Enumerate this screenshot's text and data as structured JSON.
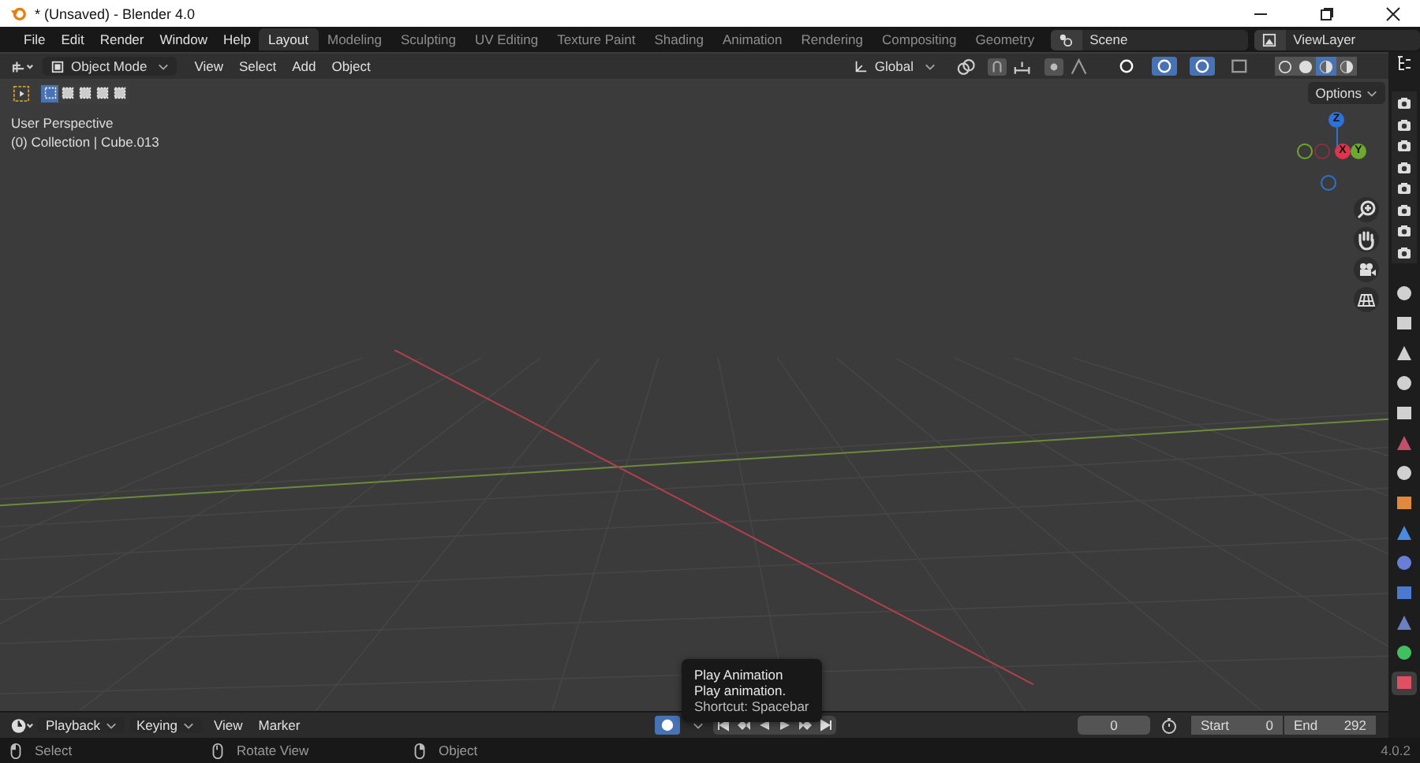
{
  "window": {
    "title": "* (Unsaved) - Blender 4.0"
  },
  "menus": [
    "File",
    "Edit",
    "Render",
    "Window",
    "Help"
  ],
  "workspaces": [
    {
      "label": "Layout",
      "selected": true
    },
    {
      "label": "Modeling",
      "selected": false
    },
    {
      "label": "Sculpting",
      "selected": false
    },
    {
      "label": "UV Editing",
      "selected": false
    },
    {
      "label": "Texture Paint",
      "selected": false
    },
    {
      "label": "Shading",
      "selected": false
    },
    {
      "label": "Animation",
      "selected": false
    },
    {
      "label": "Rendering",
      "selected": false
    },
    {
      "label": "Compositing",
      "selected": false
    },
    {
      "label": "Geometry",
      "selected": false
    }
  ],
  "scene": {
    "value": "Scene"
  },
  "view_layer": {
    "value": "ViewLayer"
  },
  "viewport_header": {
    "mode": "Object Mode",
    "menus": [
      "View",
      "Select",
      "Add",
      "Object"
    ],
    "orientation": "Global",
    "toggles": [
      {
        "on": false
      },
      {
        "on": true
      },
      {
        "on": true
      },
      {
        "on": false
      }
    ],
    "shading_modes": [
      {
        "selected": false
      },
      {
        "selected": false
      },
      {
        "selected": true
      },
      {
        "selected": false
      }
    ]
  },
  "select_modes": [
    {
      "selected": true
    },
    {
      "selected": false
    },
    {
      "selected": false
    },
    {
      "selected": false
    },
    {
      "selected": false
    }
  ],
  "viewport": {
    "perspective": "User Perspective",
    "collection": "(0) Collection | Cube.013",
    "options": "Options"
  },
  "gizmo": {
    "axes": [
      {
        "label": "Z",
        "color": "#2e72d8"
      },
      {
        "label": "X",
        "color": "#e0344e"
      },
      {
        "label": "Y",
        "color": "#6ea82c"
      }
    ]
  },
  "properties_tabs": [
    {
      "color": "#d0d0d0",
      "selected": false
    },
    {
      "color": "#d0d0d0",
      "selected": false
    },
    {
      "color": "#d0d0d0",
      "selected": false
    },
    {
      "color": "#d0d0d0",
      "selected": false
    },
    {
      "color": "#d0d0d0",
      "selected": false
    },
    {
      "color": "#c0506a",
      "selected": false
    },
    {
      "color": "#d0d0d0",
      "selected": false
    },
    {
      "color": "#e0883c",
      "selected": false
    },
    {
      "color": "#4a8ae0",
      "selected": false
    },
    {
      "color": "#6a7ed8",
      "selected": false
    },
    {
      "color": "#4a7ad0",
      "selected": false
    },
    {
      "color": "#6a80c0",
      "selected": false
    },
    {
      "color": "#40c060",
      "selected": false
    },
    {
      "color": "#e05060",
      "selected": true
    }
  ],
  "timeline": {
    "menus": [
      "Playback",
      "Keying",
      "View",
      "Marker"
    ],
    "current_frame": "0",
    "start": {
      "label": "Start",
      "value": "0"
    },
    "end": {
      "label": "End",
      "value": "292"
    },
    "auto_key": true
  },
  "tooltip": {
    "title": "Play Animation",
    "description": "Play animation.",
    "shortcut": "Shortcut: Spacebar"
  },
  "status_bar": {
    "items": [
      "Select",
      "Rotate View",
      "Object"
    ],
    "version": "4.0.2"
  }
}
